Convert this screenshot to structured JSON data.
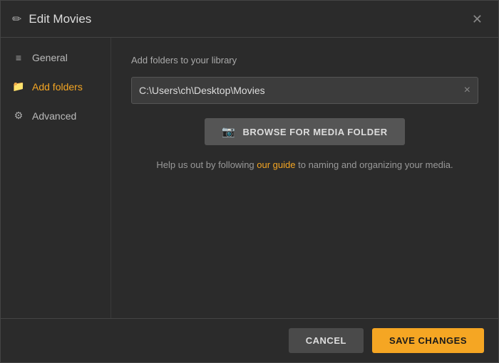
{
  "dialog": {
    "title": "Edit Movies",
    "close_icon": "✕"
  },
  "sidebar": {
    "items": [
      {
        "id": "general",
        "label": "General",
        "icon": "≡",
        "active": false
      },
      {
        "id": "add-folders",
        "label": "Add folders",
        "icon": "📁",
        "active": true
      },
      {
        "id": "advanced",
        "label": "Advanced",
        "icon": "⚙",
        "active": false
      }
    ]
  },
  "main": {
    "section_label": "Add folders to your library",
    "folder_path": "C:\\Users\\ch\\Desktop\\Movies",
    "folder_clear_label": "×",
    "browse_button_label": "BROWSE FOR MEDIA FOLDER",
    "help_text_before": "Help us out by following ",
    "help_link_label": "our guide",
    "help_text_after": " to naming and organizing your media."
  },
  "footer": {
    "cancel_label": "CANCEL",
    "save_label": "SAVE CHANGES"
  }
}
